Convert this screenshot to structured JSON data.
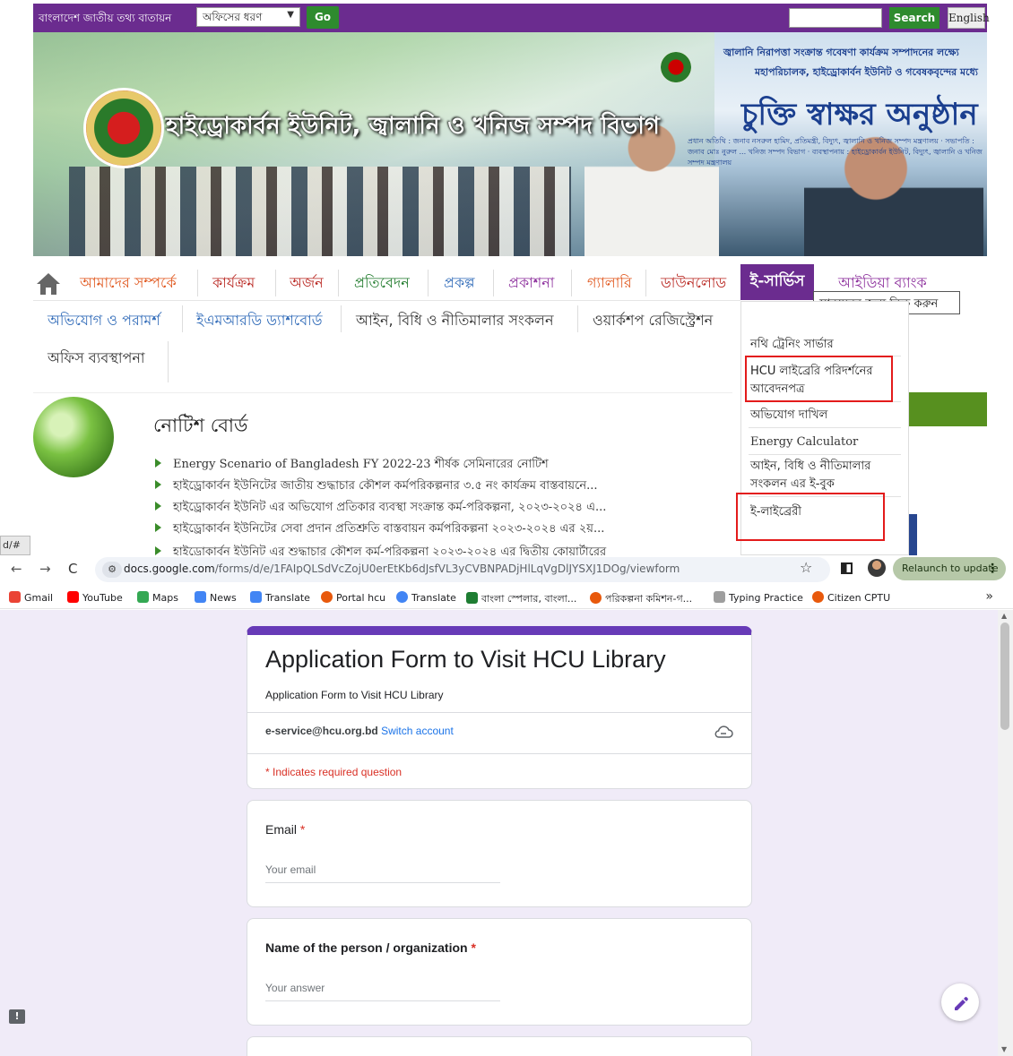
{
  "site": {
    "gov_portal": "বাংলাদেশ জাতীয় তথ্য বাতায়ন",
    "office_type": "অফিসের ধরণ",
    "go_label": "Go",
    "search_label": "Search",
    "english_label": "English",
    "title": "হাইড্রোকার্বন ইউনিট, জ্বালানি ও খনিজ সম্পদ বিভাগ",
    "banner": {
      "line1": "জ্বালানি নিরাপত্তা সংক্রান্ত গবেষণা কার্যক্রম সম্পাদনের লক্ষ্যে",
      "line2": "মহাপরিচালক, হাইড্রোকার্বন ইউনিট ও গবেষকবৃন্দের মধ্যে",
      "title": "চুক্তি স্বাক্ষর অনুষ্ঠান",
      "small": "প্রধান অতিথি : জনাব নসরুল হামিদ, প্রতিমন্ত্রী, বিদ্যুৎ, জ্বালানি ও খনিজ সম্পদ মন্ত্রণালয় · সভাপতি : জনাব মোঃ নুরুল ... খনিজ সম্পদ বিভাগ · ব্যবস্থাপনায় : হাইড্রোকার্বন ইউনিট, বিদ্যুৎ, জ্বালানি ও খনিজ সম্পদ মন্ত্রণালয়"
    },
    "menu_row1": [
      "আমাদের সম্পর্কে",
      "কার্যক্রম",
      "অর্জন",
      "প্রতিবেদন",
      "প্রকল্প",
      "প্রকাশনা",
      "গ্যালারি",
      "ডাউনলোড"
    ],
    "eservice": "ই-সার্ভিস",
    "idea_bank": "আইডিয়া ব্যাংক",
    "tooltip": "সাবমেনুর জন্য ক্লিক করুন",
    "menu_row2": [
      "অভিযোগ ও পরামর্শ",
      "ইএমআরডি ড্যাশবোর্ড",
      "আইন, বিধি ও নীতিমালার সংকলন",
      "ওয়ার্কশপ রেজিস্ট্রেশন"
    ],
    "menu_row3": [
      "অফিস ব্যবস্থাপনা"
    ],
    "dropdown": [
      "নথি ট্রেনিং সার্ভার",
      "HCU লাইব্রেরি পরিদর্শনের আবেদনপত্র",
      "অভিযোগ দাখিল",
      "Energy Calculator",
      "আইন, বিধি ও নীতিমালার সংকলন এর ই-বুক",
      "ই-লাইব্রেরী"
    ],
    "notice_title": "নোটিশ বোর্ড",
    "notices": [
      "Energy Scenario of Bangladesh FY 2022-23 শীর্ষক সেমিনারের নোটিশ",
      "হাইড্রোকার্বন ইউনিটের জাতীয় শুদ্ধাচার কৌশল কর্মপরিকল্পনার ৩.৫ নং কার্যক্রম বাস্তবায়নে...",
      "হাইড্রোকার্বন ইউনিট এর অভিযোগ প্রতিকার ব্যবস্থা সংক্রান্ত কর্ম-পরিকল্পনা, ২০২৩-২০২৪ এ...",
      "হাইড্রোকার্বন ইউনিটের সেবা প্রদান প্রতিশ্রুতি বাস্তবায়ন কর্মপরিকল্পনা ২০২৩-২০২৪ এর ২য়...",
      "হাইড্রোকার্বন ইউনিট এর শুদ্ধাচার কৌশল কর্ম-পরিকল্পনা ২০২৩-২০২৪ এর দ্বিতীয় কোয়ার্টারের"
    ],
    "status_url": "d/#"
  },
  "browser": {
    "url_host": "docs.google.com",
    "url_path": "/forms/d/e/1FAIpQLSdVcZojU0erEtKb6dJsfVL3yCVBNPADjHlLqVgDlJYSXJ1DOg/viewform",
    "relaunch": "Relaunch to update",
    "bookmarks": [
      {
        "label": "Gmail",
        "color": "#ea4335"
      },
      {
        "label": "YouTube",
        "color": "#ff0000"
      },
      {
        "label": "Maps",
        "color": "#34a853"
      },
      {
        "label": "News",
        "color": "#4285f4"
      },
      {
        "label": "Translate",
        "color": "#4285f4"
      },
      {
        "label": "Portal hcu",
        "color": "#e8590c"
      },
      {
        "label": "Translate",
        "color": "#4285f4"
      },
      {
        "label": "বাংলা স্পেলার, বাংলা...",
        "color": "#1e7d32"
      },
      {
        "label": "পরিকল্পনা কমিশন-গ...",
        "color": "#e8590c"
      },
      {
        "label": "Typing Practice",
        "color": "#9e9e9e"
      },
      {
        "label": "Citizen CPTU",
        "color": "#e8590c"
      }
    ]
  },
  "form": {
    "title": "Application Form to Visit HCU Library",
    "description": "Application Form to Visit HCU Library",
    "account_email": "e-service@hcu.org.bd",
    "switch_account": "Switch account",
    "required_note": "* Indicates required question",
    "questions": [
      {
        "label": "Email",
        "required": "*",
        "placeholder": "Your email"
      },
      {
        "label": "Name of the person / organization",
        "required": "*",
        "placeholder": "Your answer"
      }
    ]
  },
  "colors": {
    "purple": "#6b2c8f",
    "form_accent": "#673ab7",
    "required": "#d93025",
    "link": "#1a73e8"
  }
}
